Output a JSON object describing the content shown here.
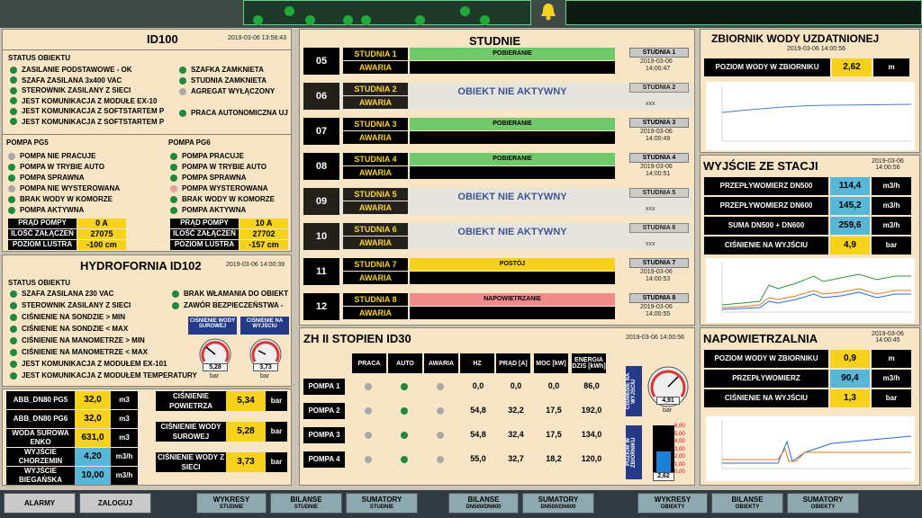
{
  "topbar": {
    "bell": "bell-icon"
  },
  "id100": {
    "title": "ID100",
    "date": "2019-03-06 13:58:43",
    "status_header": "STATUS OBIEKTU",
    "left": [
      "ZASILANIE PODSTAWOWE - OK",
      "SZAFA ZASILANA 3x400 VAC",
      "STEROWNIK ZASILANY Z SIECI",
      "JEST KOMUNIKACJA Z MODUŁE EX-10",
      "JEST KOMUNIKACJA Z SOFTSTARTEM P",
      "JEST KOMUNIKACJA Z SOFTSTARTEM P"
    ],
    "right": [
      "SZAFKA ZAMKNIETA",
      "STUDNIA ZAMKNIETA",
      "AGREGAT WYŁĄCZONY",
      "PRACA AUTONOMICZNA UJ"
    ],
    "pg5": {
      "title": "POMPA PG5",
      "items": [
        "POMPA NIE PRACUJE",
        "POMPA W TRYBIE AUTO",
        "POMPA SPRAWNA",
        "POMPA NIE WYSTEROWANA",
        "BRAK WODY W KOMORZE",
        "POMPA AKTYWNA"
      ],
      "m1l": "PRĄD POMPY",
      "m1v": "0 A",
      "m2l": "ILOŚĆ ZAŁĄCZEŃ",
      "m2v": "27075",
      "m3l": "POZIOM LUSTRA",
      "m3v": "-100 cm"
    },
    "pg6": {
      "title": "POMPA PG6",
      "items": [
        "POMPA PRACUJE",
        "POMPA W TRYBIE AUTO",
        "POMPA SPRAWNA",
        "POMPA WYSTEROWANA",
        "BRAK WODY W KOMORZE",
        "POMPA AKTYWNA"
      ],
      "m1l": "PRĄD POMPY",
      "m1v": "10 A",
      "m2l": "ILOŚĆ ZAŁĄCZEŃ",
      "m2v": "27702",
      "m3l": "POZIOM LUSTRA",
      "m3v": "-157 cm"
    }
  },
  "id102": {
    "title": "HYDROFORNIA ID102",
    "date": "2019-03-06 14:00:39",
    "status_header": "STATUS OBIEKTU",
    "left": [
      "SZAFA ZASILANA  230 VAC",
      "STEROWNIK ZASILANY Z SIECI",
      "CIŚNIENIE NA SONDZIE > MIN",
      "CIŚNIENIE NA SONDZIE < MAX",
      "CIŚNIENIE NA MANOMETRZE > MIN",
      "CIŚNIENIE NA MANOMETRZE < MAX",
      "JEST KOMUNIKACJA Z MODUŁEM EX-101",
      "JEST KOMUNIKACJA Z MODUŁEM TEMPERATURY"
    ],
    "right": [
      "BRAK WŁAMANIA DO OBIEKT",
      "ZAWÓR BEZPIECZEŃSTWA -"
    ],
    "g1": {
      "label": "CIŚNIENIE WODY SUROWEJ",
      "value": "5,28",
      "unit": "bar"
    },
    "g2": {
      "label": "CIŚNIENIE NA WYJŚCIU",
      "value": "3,73",
      "unit": "bar"
    }
  },
  "meters_left": [
    {
      "l": "ABB_DN80 PG5",
      "v": "32,0",
      "u": "m3"
    },
    {
      "l": "ABB_DN80 PG6",
      "v": "32,0",
      "u": "m3"
    },
    {
      "l": "WODA SUROWA ENKO",
      "v": "631,0",
      "u": "m3"
    },
    {
      "l": "WYJŚCIE CHORZEMIN",
      "v": "4,20",
      "u": "m3/h"
    },
    {
      "l": "WYJŚCIE BIEGAŃSKA",
      "v": "10,00",
      "u": "m3/h"
    }
  ],
  "meters_right": [
    {
      "l": "CIŚNIENIE POWIETRZA",
      "v": "5,34",
      "u": "bar"
    },
    {
      "l": "CIŚNIENIE WODY SUROWEJ",
      "v": "5,28",
      "u": "bar"
    },
    {
      "l": "CIŚNIENIE WODY Z SIECI",
      "v": "3,73",
      "u": "bar"
    }
  ],
  "studnie": {
    "title": "STUDNIE",
    "awaria": "AWARIA",
    "inactive": "OBIEKT NIE AKTYWNY",
    "wells": [
      {
        "num": "05",
        "name": "STUDNIA 1",
        "state": "POBIERANIE",
        "btn": "STUDNIA 1",
        "date": "2019-03-06",
        "time": "14:00:47"
      },
      {
        "num": "06",
        "name": "STUDNIA 2",
        "state": "",
        "btn": "STUDNIA 2",
        "date": "",
        "time": "xxx"
      },
      {
        "num": "07",
        "name": "STUDNIA 3",
        "state": "POBIERANIE",
        "btn": "STUDNIA 3",
        "date": "2019-03-06",
        "time": "14:00:49"
      },
      {
        "num": "08",
        "name": "STUDNIA 4",
        "state": "POBIERANIE",
        "btn": "STUDNIA 4",
        "date": "2019-03-06",
        "time": "14:00:51"
      },
      {
        "num": "09",
        "name": "STUDNIA 5",
        "state": "",
        "btn": "STUDNIA 5",
        "date": "",
        "time": "xxx"
      },
      {
        "num": "10",
        "name": "STUDNIA 6",
        "state": "",
        "btn": "STUDNIA 6",
        "date": "",
        "time": "xxx"
      },
      {
        "num": "11",
        "name": "STUDNIA 7",
        "state": "POSTÓJ",
        "btn": "STUDNIA 7",
        "date": "2019-03-06",
        "time": "14:00:53"
      },
      {
        "num": "12",
        "name": "STUDNIA 8",
        "state": "NAPOWIETRZANIE",
        "btn": "STUDNIA 8",
        "date": "2019-03-06",
        "time": "14:00:55"
      }
    ]
  },
  "zh": {
    "title": "ZH II STOPIEN ID30",
    "date": "2019-03-06 14:00:56",
    "headers": [
      "PRACA",
      "AUTO",
      "AWARIA",
      "HZ",
      "PRĄD [A]",
      "MOC [kW]",
      "ENERGIA DZIŚ [kWh]"
    ],
    "rows": [
      {
        "n": "POMPA 1",
        "hz": "0,0",
        "a": "0,0",
        "kw": "0,0",
        "e": "86,0"
      },
      {
        "n": "POMPA 2",
        "hz": "54,8",
        "a": "32,2",
        "kw": "17,5",
        "e": "192,0"
      },
      {
        "n": "POMPA 3",
        "hz": "54,8",
        "a": "32,4",
        "kw": "17,5",
        "e": "134,0"
      },
      {
        "n": "POMPA 4",
        "hz": "55,0",
        "a": "32,7",
        "kw": "18,2",
        "e": "120,0"
      }
    ],
    "p_label": "CIŚNIENIE NA WYJŚCIU",
    "p_value": "4,91",
    "p_unit": "bar",
    "l_label": "POZIOM W ZBIORNIKU",
    "l_value": "2,62",
    "ticks": [
      "6,00",
      "5,00",
      "4,00",
      "3,00",
      "2,00",
      "1,00",
      "0,00"
    ]
  },
  "zbiornik": {
    "title": "ZBIORNIK WODY UZDATNIONEJ",
    "date": "2019-03-06 14:00:56",
    "l": "POZIOM WODY W ZBIORNIKU",
    "v": "2,62",
    "u": "m"
  },
  "wyjscie": {
    "title": "WYJŚCIE ZE STACJI",
    "date": "2019-03-06",
    "time": "14:00:56",
    "rows": [
      {
        "l": "PRZEPŁYWOMIERZ DN500",
        "v": "114,4",
        "u": "m3/h"
      },
      {
        "l": "PRZEPŁYWOMIERZ DN600",
        "v": "145,2",
        "u": "m3/h"
      },
      {
        "l": "SUMA DN500 + DN600",
        "v": "259,6",
        "u": "m3/h"
      },
      {
        "l": "CIŚNIENIE NA WYJŚCIU",
        "v": "4,9",
        "u": "bar"
      }
    ]
  },
  "napow": {
    "title": "NAPOWIETRZALNIA",
    "date": "2019-03-06",
    "time": "14:00:45",
    "rows": [
      {
        "l": "POZIOM WODY W ZBIORNIKU",
        "v": "0,9",
        "u": "m"
      },
      {
        "l": "PRZEPŁYWOMIERZ",
        "v": "90,4",
        "u": "m3/h"
      },
      {
        "l": "CIŚNIENIE NA WYJŚCIU",
        "v": "1,3",
        "u": "bar"
      }
    ]
  },
  "bottom": [
    {
      "t": "ALARMY",
      "s": ""
    },
    {
      "t": "ZALOGUJ",
      "s": ""
    },
    {
      "t": "WYKRESY",
      "s": "STUDNIE"
    },
    {
      "t": "BILANSE",
      "s": "STUDNIE"
    },
    {
      "t": "SUMATORY",
      "s": "STUDNIE"
    },
    {
      "t": "BILANSE",
      "s": "DN500/DN600"
    },
    {
      "t": "SUMATORY",
      "s": "DN500/DN600"
    },
    {
      "t": "WYKRESY",
      "s": "OBIEKTY"
    },
    {
      "t": "BILANSE",
      "s": "OBIEKTY"
    },
    {
      "t": "SUMATORY",
      "s": "OBIEKTY"
    }
  ],
  "colors": {
    "green": "#1d8a3d",
    "yellow": "#f7d21c",
    "blue": "#58b6d8",
    "pink": "#f08c8c"
  }
}
